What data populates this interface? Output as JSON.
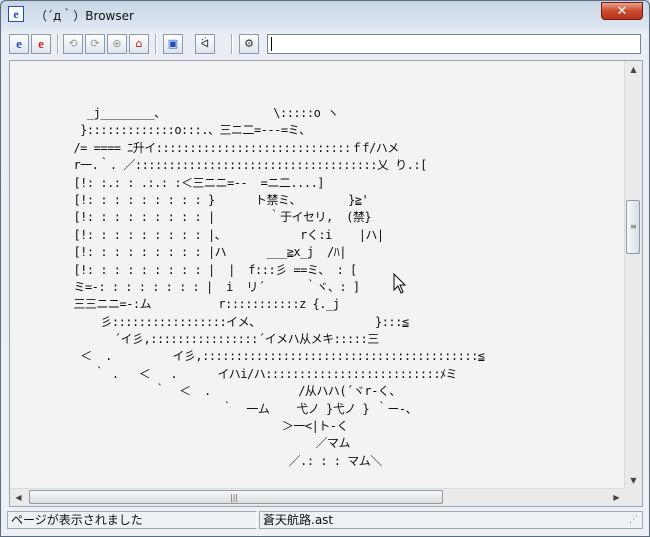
{
  "window": {
    "title": "（´д｀）Browser",
    "app_icon": "e",
    "close_label": "✕"
  },
  "toolbar": {
    "buttons": [
      {
        "name": "new-window-button",
        "glyph": "e"
      },
      {
        "name": "open-page-button",
        "glyph": "e"
      },
      {
        "name": "back-button",
        "glyph": "⟲"
      },
      {
        "name": "forward-button",
        "glyph": "⟳"
      },
      {
        "name": "stop-button",
        "glyph": "⊕"
      },
      {
        "name": "home-button",
        "glyph": "⌂"
      },
      {
        "name": "windows-button",
        "glyph": "▣"
      },
      {
        "name": "face-button",
        "glyph": "ᐛ"
      },
      {
        "name": "settings-button",
        "glyph": "⚙"
      }
    ],
    "address_value": ""
  },
  "content": {
    "ascii_art": "    _j________、                \\:::::o ヽ\n   }:::::::::::::o:::.、三ニ二=---=ミ、\n  /= ==== ﾆ升イ:::::::::::::::::::::::::::::ｆf/ハメ\n  r一.｀. ／::::::::::::::::::::::::::::::::::::乂 り.:[\n  [!: :.: : .:.: :＜三ニニ=--  =ニ二....]\n  [!: : : : : : : : : }      ト禁ミ、       }≧'\n  [!: : : : : : : : : |        ｀于イセリ,  (禁}\n  [!: : : : : : : : : |、           rく:i    |ハ|\n  [!: : : : : : : : : |ハ      ___≧x_j  /ﾊ|\n  [!: : : : : : : : : |  |  f:::彡 ==ミ、 : [\n  ミ=-: : : : : : : : |  i  リ´      ｀ヾ、: ]\n  三三ニニ=-:ム          r:::::::::::z {._j\n      彡:::::::::::::::::イメ、                 }:::≦\n        ´イ彡,::::::::::::::::´イメハ从メキ:::::三\n   ＜  .         イ彡,:::::::::::::::::::::::::::::::::::::::::≦\n     ｀ .   ＜   .      イハi/ハ::::::::::::::::::::::::::ﾒミ\n              ｀  ＜  .             /从ハハ(´ヾr-く、\n                        ｀  一ム    弋ノ }弋ノ } ｀ー-、\n                                 ＞一<|ト-く\n                                      ／マム\n                                  ／.: : : マム＼"
  },
  "statusbar": {
    "left_text": "ページが表示されました",
    "right_text": "蒼天航路.ast"
  },
  "scrollbar": {
    "vertical_position": 0.35,
    "horizontal_position": 0.0
  }
}
